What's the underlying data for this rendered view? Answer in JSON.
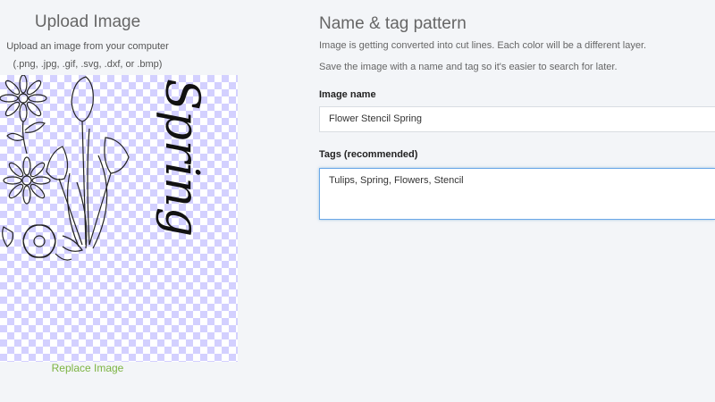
{
  "upload": {
    "title": "Upload Image",
    "subtitle": "Upload an image from your computer",
    "formats": "(.png, .jpg, .gif, .svg, .dxf, or .bmp)",
    "replace_label": "Replace Image",
    "preview_word": "Spring",
    "checker_color": "#d3d0ff"
  },
  "form": {
    "title": "Name & tag pattern",
    "description_1": "Image is getting converted into cut lines. Each color will be a different layer.",
    "description_2": "Save the image with a name and tag so it's easier to search for later.",
    "name_label": "Image name",
    "name_value": "Flower Stencil Spring",
    "tags_label": "Tags (recommended)",
    "tags_value": "Tulips, Spring, Flowers, Stencil"
  },
  "colors": {
    "link": "#7cb342",
    "focus_border": "#6aa8e8",
    "background": "#f3f5f8"
  }
}
